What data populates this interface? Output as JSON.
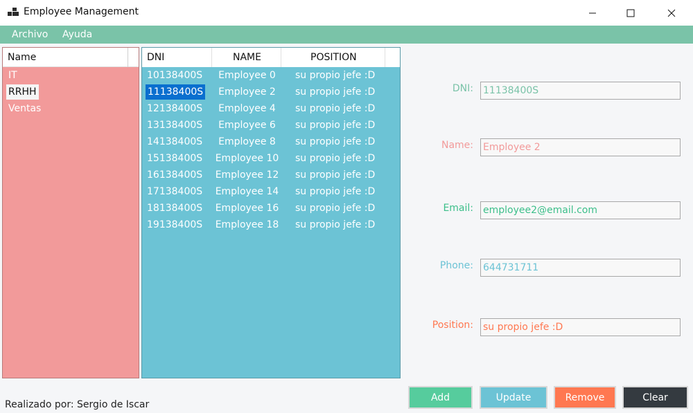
{
  "window": {
    "title": "Employee Management"
  },
  "menu": [
    "Archivo",
    "Ayuda"
  ],
  "departments": {
    "header": "Name",
    "items": [
      {
        "label": "IT",
        "selected": false
      },
      {
        "label": "RRHH",
        "selected": true
      },
      {
        "label": "Ventas",
        "selected": false
      }
    ]
  },
  "employees": {
    "columns": [
      "DNI",
      "NAME",
      "POSITION"
    ],
    "rows": [
      {
        "dni": "10138400S",
        "name": "Employee 0",
        "position": "su propio jefe :D",
        "selected": false
      },
      {
        "dni": "11138400S",
        "name": "Employee 2",
        "position": "su propio jefe :D",
        "selected": true
      },
      {
        "dni": "12138400S",
        "name": "Employee 4",
        "position": "su propio jefe :D",
        "selected": false
      },
      {
        "dni": "13138400S",
        "name": "Employee 6",
        "position": "su propio jefe :D",
        "selected": false
      },
      {
        "dni": "14138400S",
        "name": "Employee 8",
        "position": "su propio jefe :D",
        "selected": false
      },
      {
        "dni": "15138400S",
        "name": "Employee 10",
        "position": "su propio jefe :D",
        "selected": false
      },
      {
        "dni": "16138400S",
        "name": "Employee 12",
        "position": "su propio jefe :D",
        "selected": false
      },
      {
        "dni": "17138400S",
        "name": "Employee 14",
        "position": "su propio jefe :D",
        "selected": false
      },
      {
        "dni": "18138400S",
        "name": "Employee 16",
        "position": "su propio jefe :D",
        "selected": false
      },
      {
        "dni": "19138400S",
        "name": "Employee 18",
        "position": "su propio jefe :D",
        "selected": false
      }
    ]
  },
  "form": {
    "dni": {
      "label": "DNI:",
      "value": "11138400S",
      "color": "#7ac3a8"
    },
    "name": {
      "label": "Name:",
      "value": "Employee 2",
      "color": "#f29a9a"
    },
    "email": {
      "label": "Email:",
      "value": "employee2@email.com",
      "color": "#3cbf8a"
    },
    "phone": {
      "label": "Phone:",
      "value": "644731711",
      "color": "#6cc3d5"
    },
    "position": {
      "label": "Position:",
      "value": "su propio jefe :D",
      "color": "#ff7851"
    }
  },
  "buttons": {
    "add": {
      "label": "Add",
      "color": "#56cc9d"
    },
    "update": {
      "label": "Update",
      "color": "#6cc3d5"
    },
    "remove": {
      "label": "Remove",
      "color": "#ff7851"
    },
    "clear": {
      "label": "Clear",
      "color": "#343a40"
    }
  },
  "footer": {
    "text": "Realizado por: Sergio de Iscar"
  }
}
